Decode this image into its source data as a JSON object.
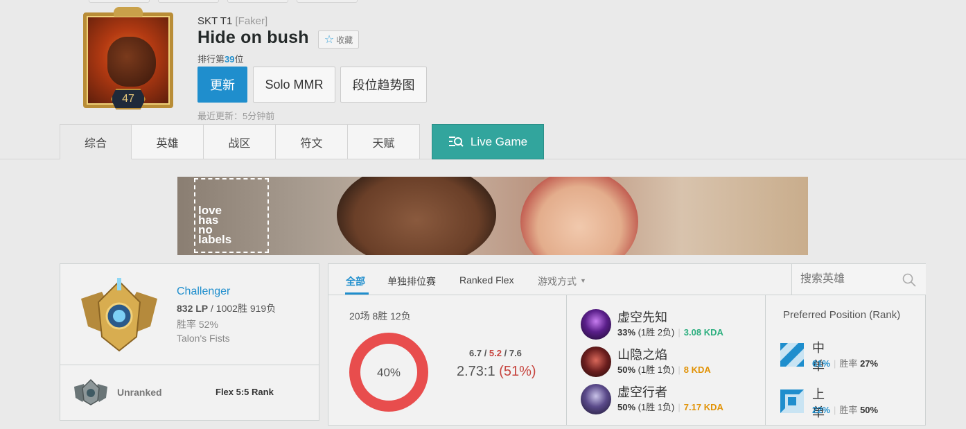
{
  "colors": {
    "accent": "#1f8ecd",
    "live": "#32a59d",
    "loss": "#e84d4d",
    "win": "#1f8ecd"
  },
  "header": {
    "team": "SKT T1",
    "tag": "[Faker]",
    "summoner_name": "Hide on bush",
    "favorite_label": "收藏",
    "ladder_prefix": "排行第",
    "ladder_rank": "39",
    "ladder_suffix": "位",
    "level": "47",
    "buttons": {
      "refresh": "更新",
      "solo_mmr": "Solo MMR",
      "tier_graph": "段位趋势图"
    },
    "last_update": "最近更新：5分钟前"
  },
  "tabs": [
    "综合",
    "英雄",
    "战区",
    "符文",
    "天赋"
  ],
  "live_game_label": "Live Game",
  "banner": {
    "logo_lines": [
      "love",
      "has",
      "no",
      "labels"
    ]
  },
  "rank": {
    "tier": "Challenger",
    "lp": "832 LP",
    "record": " / 1002胜 919负",
    "winrate": "胜率 52%",
    "league": "Talon's Fists",
    "flex_status": "Unranked",
    "flex_title": "Flex 5:5 Rank"
  },
  "games": {
    "tabs": [
      "全部",
      "单独排位赛",
      "Ranked Flex",
      "游戏方式"
    ],
    "search_placeholder": "搜索英雄",
    "summary": "20场 8胜 12负",
    "winrate_label": "40%",
    "winrate_fraction": 0.4,
    "kills": "6.7",
    "deaths": "5.2",
    "assists": "7.6",
    "kda_ratio": "2.73:1",
    "kda_pct": "(51%)",
    "champions": [
      {
        "name": "虚空先知",
        "winrate": "33%",
        "record": "(1胜 2负)",
        "kda": "3.08 KDA"
      },
      {
        "name": "山隐之焰",
        "winrate": "50%",
        "record": "(1胜 1负)",
        "kda": "8 KDA"
      },
      {
        "name": "虚空行者",
        "winrate": "50%",
        "record": "(1胜 1负)",
        "kda": "7.17 KDA"
      }
    ],
    "position_title": "Preferred Position (Rank)",
    "positions": [
      {
        "name": "中单",
        "share": "61%",
        "winrate_label": "胜率",
        "winrate": "27%"
      },
      {
        "name": "上单",
        "share": "22%",
        "winrate_label": "胜率",
        "winrate": "50%"
      }
    ]
  }
}
